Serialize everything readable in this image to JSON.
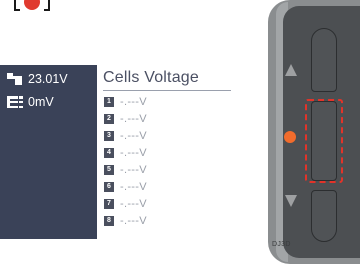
{
  "colors": {
    "sidebar_bg": "#3a4258",
    "panel_bg": "#ffffff",
    "highlight_red": "#e23329",
    "led_orange": "#f26c2c",
    "device_body": "#4c4f52"
  },
  "sidebar": {
    "battery": {
      "icon": "battery-pack-icon",
      "value": "23.01V"
    },
    "difference": {
      "icon": "cell-sum-icon",
      "value": "0mV"
    }
  },
  "panel": {
    "title": "Cells Voltage",
    "cells": [
      {
        "index": "1",
        "value": "-.---V"
      },
      {
        "index": "2",
        "value": "-.---V"
      },
      {
        "index": "3",
        "value": "-.---V"
      },
      {
        "index": "4",
        "value": "-.---V"
      },
      {
        "index": "5",
        "value": "-.---V"
      },
      {
        "index": "6",
        "value": "-.---V"
      },
      {
        "index": "7",
        "value": "-.---V"
      },
      {
        "index": "8",
        "value": "-.---V"
      }
    ]
  },
  "device": {
    "up_icon": "up-arrow-icon",
    "down_icon": "down-arrow-icon",
    "led_icon": "status-led-icon",
    "brand_text": "DJ3D"
  }
}
